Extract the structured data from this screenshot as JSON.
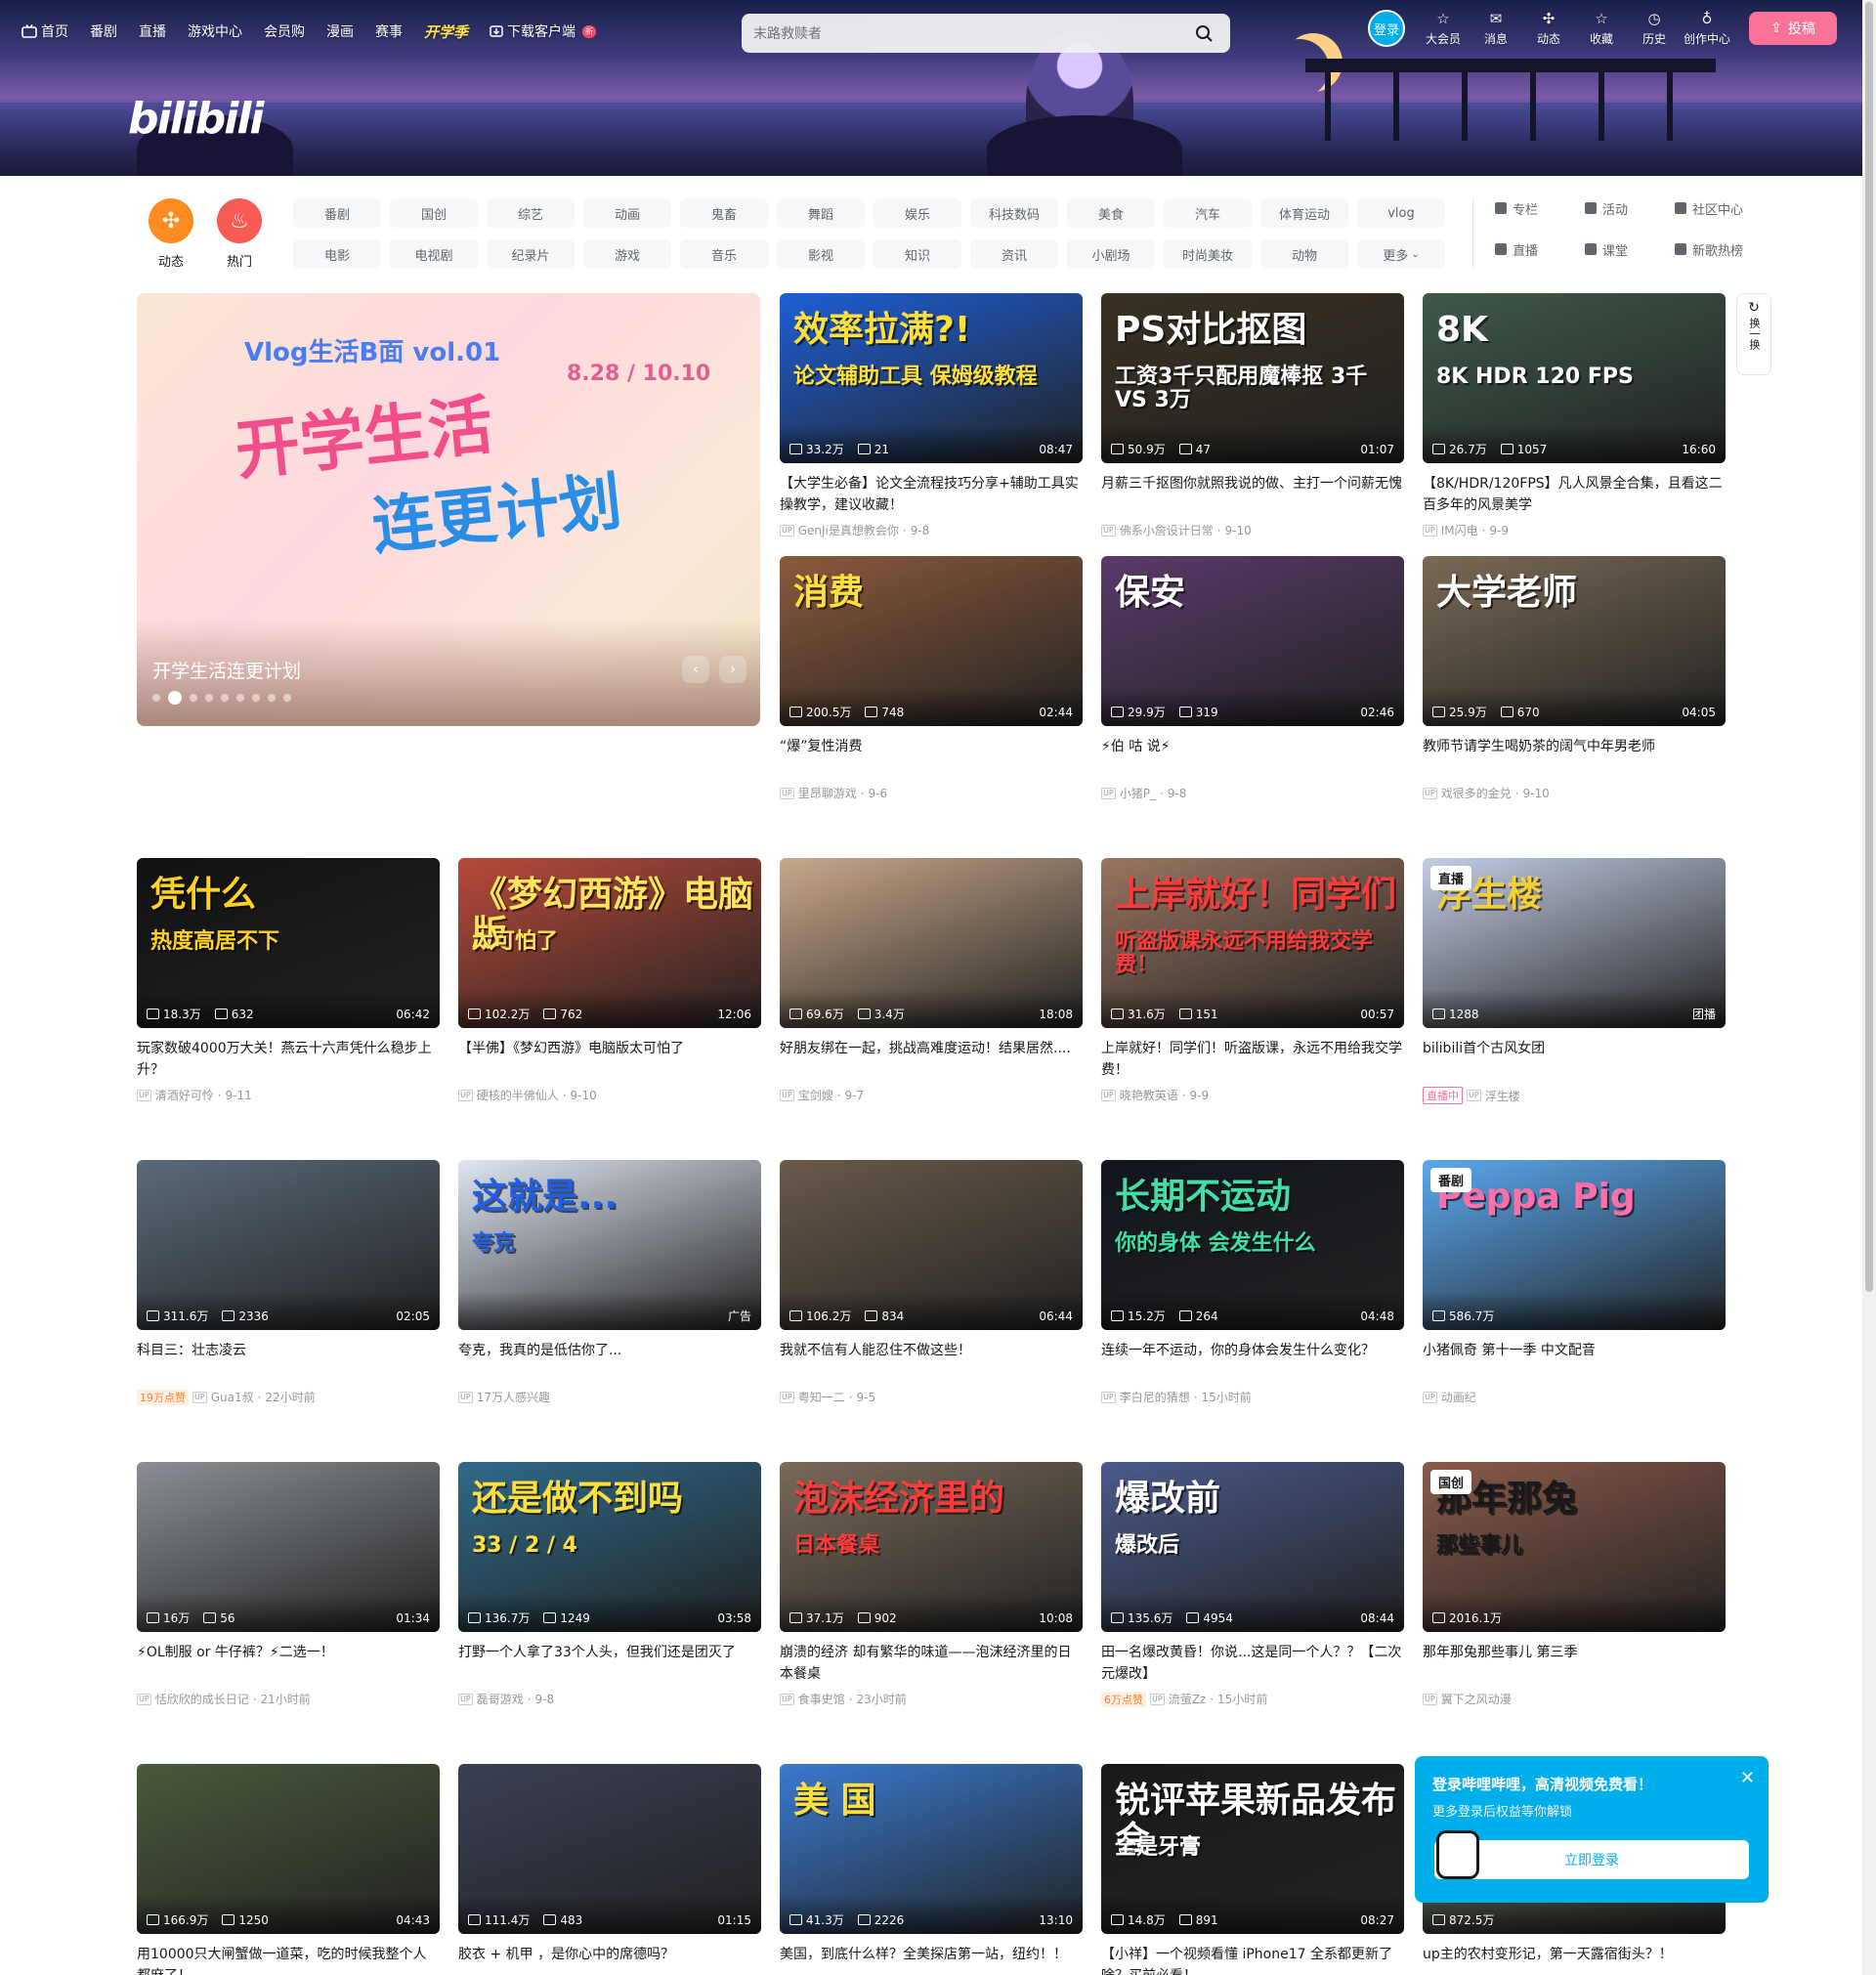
{
  "nav": {
    "items": [
      "首页",
      "番剧",
      "直播",
      "游戏中心",
      "会员购",
      "漫画",
      "赛事",
      "开学季",
      "下载客户端"
    ],
    "new_badge": "新",
    "search_placeholder": "末路救赎者",
    "login": "登录",
    "right": [
      "大会员",
      "消息",
      "动态",
      "收藏",
      "历史",
      "创作中心"
    ],
    "upload": "投稿"
  },
  "logo": "bilibili",
  "channels": {
    "circles": [
      {
        "label": "动态",
        "color": "#ff8c21"
      },
      {
        "label": "热门",
        "color": "#f85a54"
      }
    ],
    "tags": [
      "番剧",
      "国创",
      "综艺",
      "动画",
      "鬼畜",
      "舞蹈",
      "娱乐",
      "科技数码",
      "美食",
      "汽车",
      "体育运动",
      "vlog",
      "电影",
      "电视剧",
      "纪录片",
      "游戏",
      "音乐",
      "影视",
      "知识",
      "资讯",
      "小剧场",
      "时尚美妆",
      "动物",
      "更多"
    ],
    "extras": [
      "专栏",
      "活动",
      "社区中心",
      "直播",
      "课堂",
      "新歌热榜"
    ]
  },
  "carousel": {
    "title_line1": "Vlog生活B面 vol.01",
    "title_line2": "开学生活",
    "title_line3": "连更计划",
    "date": "8.28 / 10.10",
    "caption": "开学生活连更计划"
  },
  "refresh_label": "换一换",
  "cards": [
    {
      "title": "【大学生必备】论文全流程技巧分享+辅助工具实操教学，建议收藏！",
      "plays": "33.2万",
      "danmaku": "21",
      "duration": "08:47",
      "up": "GenJi是真想教会你",
      "date": "9-8",
      "cover_text": "效率拉满?!",
      "cover_text2": "论文辅助工具 保姆级教程",
      "bg": "#1e5fd6",
      "fg": "#ffe03a"
    },
    {
      "title": "月薪三千抠图你就照我说的做、主打一个问薪无愧",
      "plays": "50.9万",
      "danmaku": "47",
      "duration": "01:07",
      "up": "佛系小詹设计日常",
      "date": "9-10",
      "cover_text": "PS对比抠图",
      "cover_text2": "工资3千只配用魔棒抠 3千 VS 3万",
      "bg": "#3a3122",
      "fg": "#ffffff"
    },
    {
      "title": "【8K/HDR/120FPS】凡人风景全合集，且看这二百多年的风景美学",
      "plays": "26.7万",
      "danmaku": "1057",
      "duration": "16:60",
      "up": "IM闪电",
      "date": "9-9",
      "cover_text": "8K",
      "cover_text2": "8K HDR 120 FPS",
      "bg": "#3e5a4a",
      "fg": "#ffffff"
    },
    {
      "title": "“爆”复性消费",
      "plays": "200.5万",
      "danmaku": "748",
      "duration": "02:44",
      "up": "里昂聊游戏",
      "date": "9-6",
      "cover_text": "消费",
      "cover_text2": "",
      "bg": "#8b5a3c",
      "fg": "#ffe03a"
    },
    {
      "title": "⚡伯 咕 说⚡",
      "plays": "29.9万",
      "danmaku": "319",
      "duration": "02:46",
      "up": "小猪P_",
      "date": "9-8",
      "cover_text": "保安",
      "cover_text2": "",
      "bg": "#5a3a6a",
      "fg": "#ffffff"
    },
    {
      "title": "教师节请学生喝奶茶的阔气中年男老师",
      "plays": "25.9万",
      "danmaku": "670",
      "duration": "04:05",
      "up": "戏很多的金兑",
      "date": "9-10",
      "cover_text": "大学老师",
      "cover_text2": "",
      "bg": "#7a6a55",
      "fg": "#ffffff"
    },
    {
      "title": "玩家数破4000万大关！燕云十六声凭什么稳步上升？",
      "plays": "18.3万",
      "danmaku": "632",
      "duration": "06:42",
      "up": "清酒好可怜",
      "date": "9-11",
      "cover_text": "凭什么",
      "cover_text2": "热度高居不下",
      "bg": "#111111",
      "fg": "#ffd21f"
    },
    {
      "title": "【半佛】《梦幻西游》电脑版太可怕了",
      "plays": "102.2万",
      "danmaku": "762",
      "duration": "12:06",
      "up": "硬核的半佛仙人",
      "date": "9-10",
      "cover_text": "《梦幻西游》电脑版",
      "cover_text2": "太可怕了",
      "bg": "#b84a3a",
      "fg": "#ffe35a"
    },
    {
      "title": "好朋友绑在一起，挑战高难度运动！结果居然....",
      "plays": "69.6万",
      "danmaku": "3.4万",
      "duration": "18:08",
      "up": "宝剑嫂",
      "date": "9-7",
      "cover_text": "",
      "cover_text2": "",
      "bg": "#c9a88a",
      "fg": "#ffffff"
    },
    {
      "title": "上岸就好！同学们！听盗版课，永远不用给我交学费！",
      "plays": "31.6万",
      "danmaku": "151",
      "duration": "00:57",
      "up": "晓艳教英语",
      "date": "9-9",
      "cover_text": "上岸就好！同学们",
      "cover_text2": "听盗版课永远不用给我交学费！",
      "bg": "#9a7560",
      "fg": "#ff3a3a"
    },
    {
      "title": "bilibili首个古风女团",
      "plays": "1288",
      "danmaku": "",
      "duration": "团播",
      "up": "浮生楼",
      "date": "",
      "cover_text": "浮生楼",
      "cover_text2": "",
      "bg": "#c3cde6",
      "fg": "#f2d03a",
      "label": "直播",
      "live": "直播中"
    },
    {
      "title": "科目三：壮志凌云",
      "plays": "311.6万",
      "danmaku": "2336",
      "duration": "02:05",
      "up": "Gua1叔",
      "date": "22小时前",
      "cover_text": "",
      "cover_text2": "",
      "bg": "#5a6a7a",
      "fg": "#ffffff",
      "hot": "19万点赞"
    },
    {
      "title": "夸克，我真的是低估你了...",
      "plays": "",
      "danmaku": "",
      "duration": "广告",
      "up": "17万人感兴趣",
      "date": "",
      "cover_text": "这就是...",
      "cover_text2": "夸克",
      "bg": "#dfe6f2",
      "fg": "#1f5fe8"
    },
    {
      "title": "我就不信有人能忍住不做这些！",
      "plays": "106.2万",
      "danmaku": "834",
      "duration": "06:44",
      "up": "粤知一二",
      "date": "9-5",
      "cover_text": "",
      "cover_text2": "",
      "bg": "#6a5a4a",
      "fg": "#ffffff"
    },
    {
      "title": "连续一年不运动，你的身体会发生什么变化？",
      "plays": "15.2万",
      "danmaku": "264",
      "duration": "04:48",
      "up": "李白尼的猜想",
      "date": "15小时前",
      "cover_text": "长期不运动",
      "cover_text2": "你的身体 会发生什么",
      "bg": "#11151d",
      "fg": "#3fe0a8"
    },
    {
      "title": "小猪佩奇 第十一季 中文配音",
      "plays": "586.7万",
      "danmaku": "",
      "duration": "",
      "up": "动画纪",
      "date": "",
      "cover_text": "Peppa Pig",
      "cover_text2": "",
      "bg": "#5aa8f0",
      "fg": "#ff6fa8",
      "label": "番剧"
    },
    {
      "title": "⚡OL制服 or 牛仔裤？⚡二选一！",
      "plays": "16万",
      "danmaku": "56",
      "duration": "01:34",
      "up": "恬欣欣的成长日记",
      "date": "21小时前",
      "cover_text": "",
      "cover_text2": "",
      "bg": "#8a8f95",
      "fg": "#ffffff"
    },
    {
      "title": "打野一个人拿了33个人头，但我们还是团灭了",
      "plays": "136.7万",
      "danmaku": "1249",
      "duration": "03:58",
      "up": "磊哥游戏",
      "date": "9-8",
      "cover_text": "还是做不到吗",
      "cover_text2": "33 / 2 / 4",
      "bg": "#2f6a8a",
      "fg": "#ffe03a"
    },
    {
      "title": "崩溃的经济 却有繁华的味道——泡沫经济里的日本餐桌",
      "plays": "37.1万",
      "danmaku": "902",
      "duration": "10:08",
      "up": "食事史馆",
      "date": "23小时前",
      "cover_text": "泡沫经济里的",
      "cover_text2": "日本餐桌",
      "bg": "#7a6a5a",
      "fg": "#ff3a3a"
    },
    {
      "title": "田一名爆改黄昏！你说...这是同一个人？？【二次元爆改】",
      "plays": "135.6万",
      "danmaku": "4954",
      "duration": "08:44",
      "up": "流萤Zz",
      "date": "15小时前",
      "cover_text": "爆改前",
      "cover_text2": "爆改后",
      "bg": "#4a5a8a",
      "fg": "#ffffff",
      "hot": "6万点赞"
    },
    {
      "title": "那年那兔那些事儿 第三季",
      "plays": "2016.1万",
      "danmaku": "",
      "duration": "",
      "up": "翼下之风动漫",
      "date": "",
      "cover_text": "那年那兔",
      "cover_text2": "那些事儿",
      "bg": "#8a5a4a",
      "fg": "#18191c",
      "label": "国创"
    },
    {
      "title": "用10000只大闸蟹做一道菜，吃的时候我整个人都麻了！",
      "plays": "166.9万",
      "danmaku": "1250",
      "duration": "04:43",
      "up": "",
      "date": "",
      "cover_text": "",
      "cover_text2": "",
      "bg": "#4a5a3a",
      "fg": "#ffffff"
    },
    {
      "title": "胶衣 + 机甲 ，是你心中的席德吗？",
      "plays": "111.4万",
      "danmaku": "483",
      "duration": "01:15",
      "up": "",
      "date": "",
      "cover_text": "",
      "cover_text2": "",
      "bg": "#3a3f55",
      "fg": "#ffffff"
    },
    {
      "title": "美国，到底什么样？全美探店第一站，纽约！！",
      "plays": "41.3万",
      "danmaku": "2226",
      "duration": "13:10",
      "up": "",
      "date": "",
      "cover_text": "美 国",
      "cover_text2": "",
      "bg": "#3a7ad0",
      "fg": "#ffe03a"
    },
    {
      "title": "【小祥】一个视频看懂 iPhone17 全系都更新了啥？买前必看！",
      "plays": "14.8万",
      "danmaku": "891",
      "duration": "08:27",
      "up": "",
      "date": "",
      "cover_text": "锐评苹果新品发布会",
      "cover_text2": "全是牙膏",
      "bg": "#1a1a1a",
      "fg": "#ffffff"
    },
    {
      "title": "up主的农村变形记，第一天露宿街头？！",
      "plays": "872.5万",
      "danmaku": "",
      "duration": "",
      "up": "",
      "date": "",
      "cover_text": "",
      "cover_text2": "",
      "bg": "#6a7a5a",
      "fg": "#ffffff"
    }
  ],
  "popup": {
    "heading": "登录哔哩哔哩，高清视频免费看！",
    "sub": "更多登录后权益等你解锁",
    "button": "立即登录"
  }
}
